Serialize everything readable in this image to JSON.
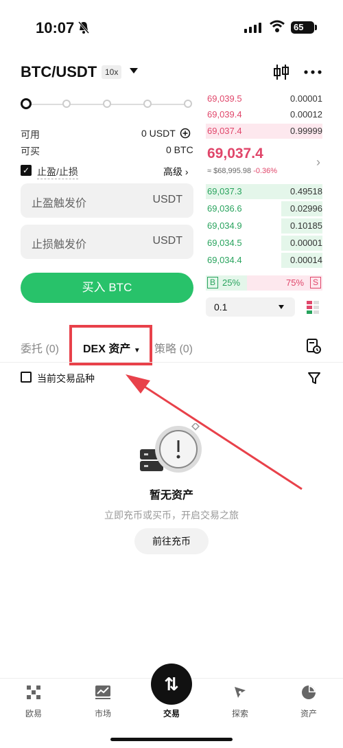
{
  "status": {
    "time": "10:07",
    "battery": "65"
  },
  "header": {
    "pair": "BTC/USDT",
    "leverage": "10x"
  },
  "form": {
    "available_label": "可用",
    "available_value": "0 USDT",
    "buyable_label": "可买",
    "buyable_value": "0 BTC",
    "tpsl_label": "止盈/止损",
    "advanced_label": "高级 ›",
    "tp_placeholder": "止盈触发价",
    "sl_placeholder": "止损触发价",
    "unit": "USDT",
    "buy_label": "买入 BTC"
  },
  "orderbook": {
    "asks": [
      {
        "price": "69,039.5",
        "qty": "0.00001"
      },
      {
        "price": "69,039.4",
        "qty": "0.00012"
      },
      {
        "price": "69,037.4",
        "qty": "0.99999"
      }
    ],
    "mid_price": "69,037.4",
    "mid_index": "≈ $68,995.98",
    "mid_change": "-0.36%",
    "bids": [
      {
        "price": "69,037.3",
        "qty": "0.49518"
      },
      {
        "price": "69,036.6",
        "qty": "0.02996"
      },
      {
        "price": "69,034.9",
        "qty": "0.10185"
      },
      {
        "price": "69,034.5",
        "qty": "0.00001"
      },
      {
        "price": "69,034.4",
        "qty": "0.00014"
      }
    ],
    "buy_tag": "B",
    "buy_pct": "25%",
    "sell_pct": "75%",
    "sell_tag": "S",
    "precision": "0.1"
  },
  "tabs": {
    "orders": "委托 (0)",
    "dex": "DEX 资产",
    "strategy": "策略 (0)"
  },
  "filter": {
    "current_only": "当前交易品种"
  },
  "empty": {
    "title": "暂无资产",
    "subtitle": "立即充币或买币，开启交易之旅",
    "deposit": "前往充币"
  },
  "nav": {
    "home": "欧易",
    "market": "市场",
    "trade": "交易",
    "explore": "探索",
    "assets": "资产"
  }
}
